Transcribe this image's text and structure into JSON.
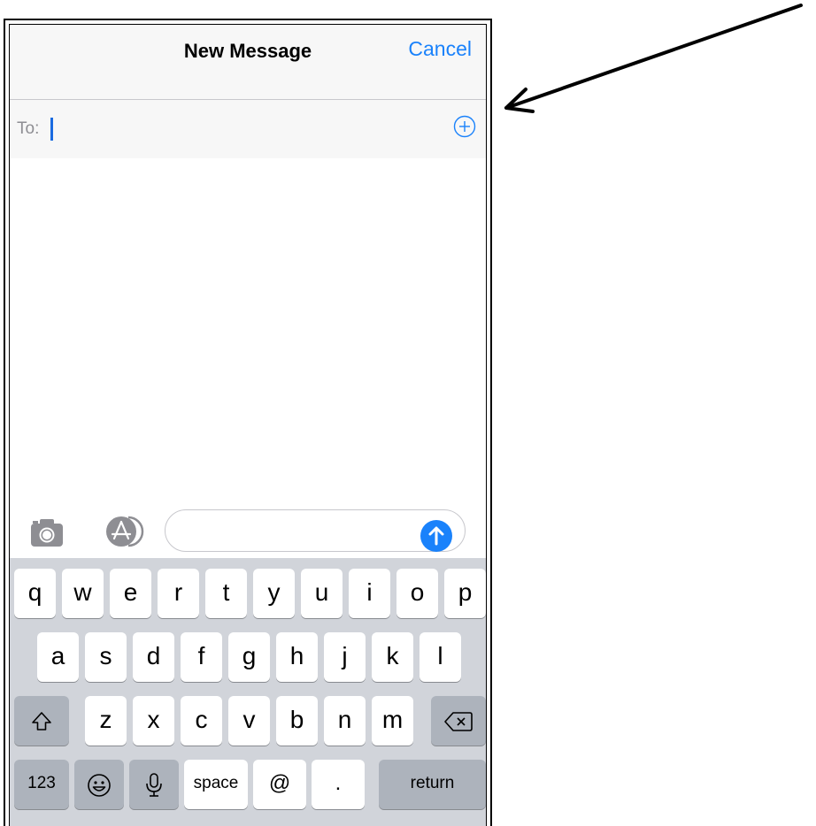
{
  "header": {
    "title": "New Message",
    "cancel_label": "Cancel"
  },
  "recipient": {
    "label": "To:",
    "value": ""
  },
  "keyboard": {
    "row1": [
      "q",
      "w",
      "e",
      "r",
      "t",
      "y",
      "u",
      "i",
      "o",
      "p"
    ],
    "row2": [
      "a",
      "s",
      "d",
      "f",
      "g",
      "h",
      "j",
      "k",
      "l"
    ],
    "row3": [
      "z",
      "x",
      "c",
      "v",
      "b",
      "n",
      "m"
    ],
    "numbers_label": "123",
    "space_label": "space",
    "at_label": "@",
    "period_label": ".",
    "return_label": "return"
  },
  "icons": {
    "add_contact": "plus-circle-icon",
    "camera": "camera-icon",
    "apps": "app-store-icon",
    "send": "arrow-up-icon",
    "shift": "shift-icon",
    "delete": "delete-icon",
    "emoji": "emoji-icon",
    "mic": "microphone-icon"
  },
  "colors": {
    "accent": "#1a82fb",
    "keyboard_bg": "#d1d4da",
    "key_dark": "#adb3bc"
  }
}
